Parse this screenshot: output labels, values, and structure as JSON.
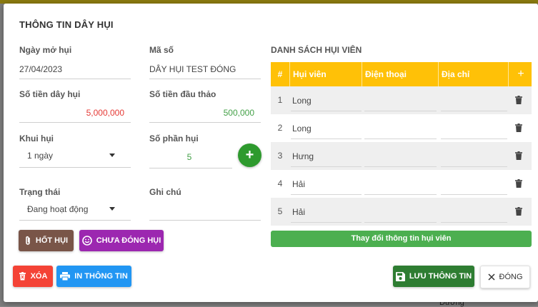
{
  "modal": {
    "title": "THÔNG TIN DÂY HỤI"
  },
  "form": {
    "start_date": {
      "label": "Ngày mở hụi",
      "value": "27/04/2023"
    },
    "code": {
      "label": "Mã số",
      "value": "DÂY HỤI TEST ĐÓNG"
    },
    "amount": {
      "label": "Số tiền dây hụi",
      "value": "5,000,000"
    },
    "first_bid": {
      "label": "Số tiền đầu thảo",
      "value": "500,000"
    },
    "period": {
      "label": "Khui hụi",
      "value": "1 ngày"
    },
    "shares": {
      "label": "Số phần hụi",
      "value": "5"
    },
    "status": {
      "label": "Trạng thái",
      "value": "Đang hoạt động"
    },
    "note": {
      "label": "Ghi chú",
      "value": ""
    }
  },
  "buttons": {
    "end": "HỐT HỤI",
    "unpaid": "CHƯA ĐÓNG HỤI",
    "delete": "XÓA",
    "print": "IN THÔNG TIN",
    "save": "LƯU THÔNG TIN",
    "close": "ĐÓNG"
  },
  "members": {
    "section_title": "DANH SÁCH HỤI VIÊN",
    "columns": [
      "#",
      "Hụi viên",
      "Điện thoại",
      "Địa chỉ",
      "+"
    ],
    "rows": [
      {
        "num": "1",
        "name": "Long",
        "phone": "",
        "address": ""
      },
      {
        "num": "2",
        "name": "Long",
        "phone": "",
        "address": ""
      },
      {
        "num": "3",
        "name": "Hưng",
        "phone": "",
        "address": ""
      },
      {
        "num": "4",
        "name": "Hải",
        "phone": "",
        "address": ""
      },
      {
        "num": "5",
        "name": "Hải",
        "phone": "",
        "address": ""
      }
    ],
    "change_button": "Thay đổi thông tin hụi viên"
  },
  "background": {
    "peek_text": "Dương"
  },
  "colors": {
    "header": "#ffc107",
    "end_button": "#795548",
    "unpaid_button": "#9c27b0",
    "delete_button": "#f44336",
    "print_button": "#2196f3",
    "save_button": "#2e7d32",
    "change_bar": "#4caf50"
  }
}
